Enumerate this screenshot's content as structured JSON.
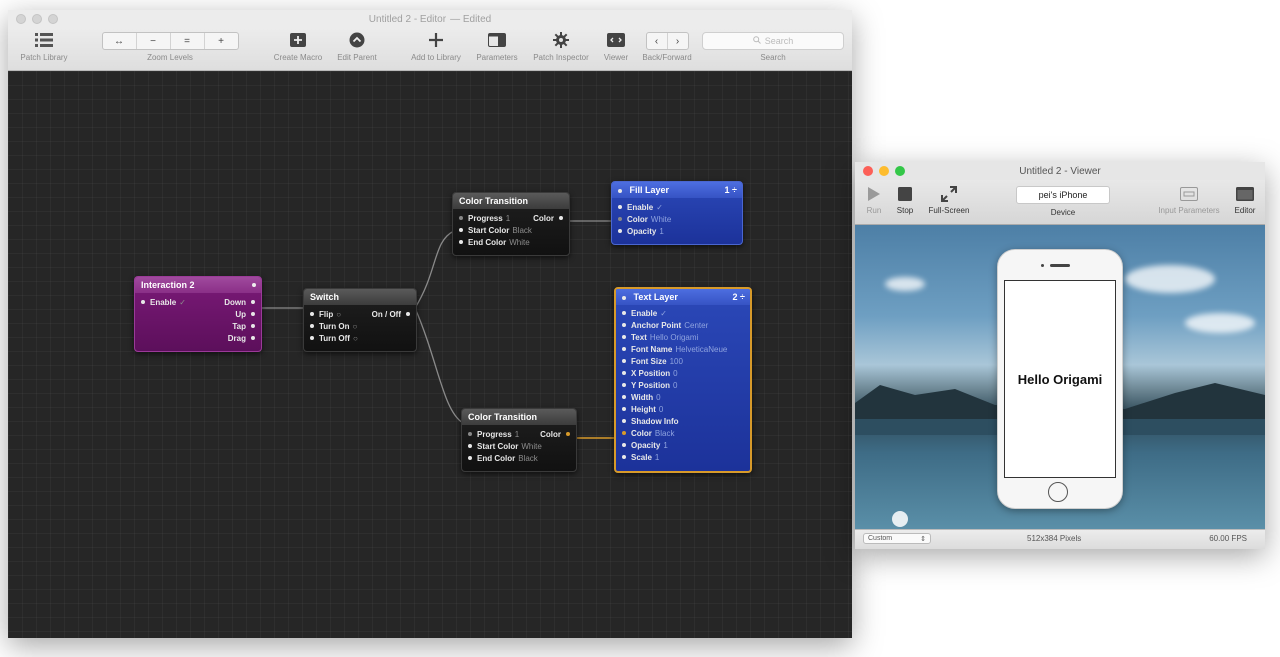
{
  "editor": {
    "title": "Untitled 2 - Editor",
    "title_status": "— Edited",
    "toolbar": {
      "patch_library": "Patch Library",
      "zoom_buttons": [
        "↔",
        "−",
        "=",
        "+"
      ],
      "zoom_levels": "Zoom Levels",
      "create_macro": "Create Macro",
      "edit_parent": "Edit Parent",
      "add_to_library": "Add to Library",
      "parameters": "Parameters",
      "patch_inspector": "Patch Inspector",
      "viewer": "Viewer",
      "back_forward": "Back/Forward",
      "search_placeholder": "Search",
      "search": "Search"
    },
    "patches": {
      "interaction": {
        "title": "Interaction 2",
        "inputs": [
          {
            "name": "Enable",
            "value": "✓"
          }
        ],
        "outputs": [
          "Down",
          "Up",
          "Tap",
          "Drag"
        ]
      },
      "switch": {
        "title": "Switch",
        "inputs": [
          {
            "name": "Flip",
            "value": "○"
          },
          {
            "name": "Turn On",
            "value": "○"
          },
          {
            "name": "Turn Off",
            "value": "○"
          }
        ],
        "output": "On / Off"
      },
      "color_transition_1": {
        "title": "Color Transition",
        "inputs": [
          {
            "name": "Progress",
            "value": "1"
          },
          {
            "name": "Start Color",
            "value": "Black"
          },
          {
            "name": "End Color",
            "value": "White"
          }
        ],
        "output": "Color"
      },
      "color_transition_2": {
        "title": "Color Transition",
        "inputs": [
          {
            "name": "Progress",
            "value": "1"
          },
          {
            "name": "Start Color",
            "value": "White"
          },
          {
            "name": "End Color",
            "value": "Black"
          }
        ],
        "output": "Color"
      },
      "fill_layer": {
        "title": "Fill Layer",
        "index": "1 ÷",
        "inputs": [
          {
            "name": "Enable",
            "value": "✓"
          },
          {
            "name": "Color",
            "value": "White"
          },
          {
            "name": "Opacity",
            "value": "1"
          }
        ]
      },
      "text_layer": {
        "title": "Text Layer",
        "index": "2 ÷",
        "inputs": [
          {
            "name": "Enable",
            "value": "✓"
          },
          {
            "name": "Anchor Point",
            "value": "Center"
          },
          {
            "name": "Text",
            "value": "Hello Origami"
          },
          {
            "name": "Font Name",
            "value": "HelveticaNeue"
          },
          {
            "name": "Font Size",
            "value": "100"
          },
          {
            "name": "X Position",
            "value": "0"
          },
          {
            "name": "Y Position",
            "value": "0"
          },
          {
            "name": "Width",
            "value": "0"
          },
          {
            "name": "Height",
            "value": "0"
          },
          {
            "name": "Shadow Info",
            "value": ""
          },
          {
            "name": "Color",
            "value": "Black"
          },
          {
            "name": "Opacity",
            "value": "1"
          },
          {
            "name": "Scale",
            "value": "1"
          }
        ]
      }
    }
  },
  "viewer": {
    "title": "Untitled 2 - Viewer",
    "toolbar": {
      "run": "Run",
      "stop": "Stop",
      "full_screen": "Full-Screen",
      "device_value": "pei's iPhone",
      "device": "Device",
      "input_parameters": "Input Parameters",
      "editor": "Editor"
    },
    "phone_text": "Hello Origami",
    "status": {
      "size_select": "Custom",
      "pixels": "512x384 Pixels",
      "fps": "60.00 FPS"
    }
  },
  "colors": {
    "interaction_patch": "#7b1a78",
    "layer_patch": "#2b48b8",
    "selection": "#d79a2a"
  }
}
